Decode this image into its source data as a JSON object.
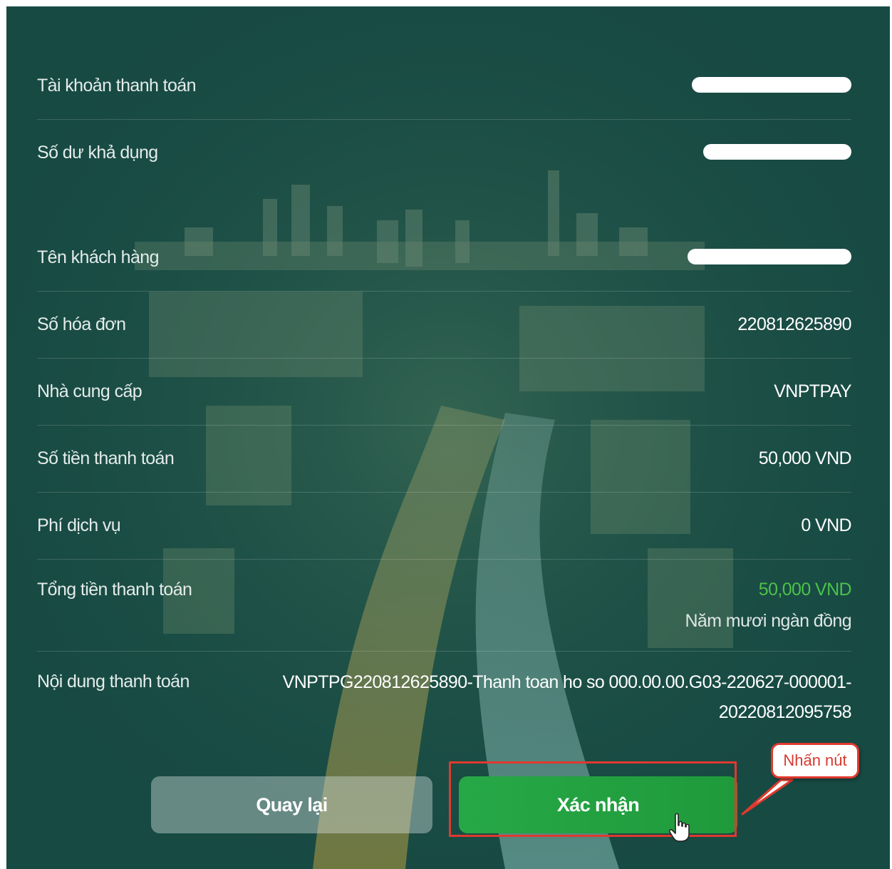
{
  "rows": [
    {
      "label": "Tài khoản thanh toán",
      "value": ""
    },
    {
      "label": "Số dư khả dụng",
      "value": ""
    },
    {
      "label": "Tên khách hàng",
      "value": ""
    },
    {
      "label": "Số hóa đơn",
      "value": "220812625890"
    },
    {
      "label": "Nhà cung cấp",
      "value": "VNPTPAY"
    },
    {
      "label": "Số tiền thanh toán",
      "value": "50,000 VND"
    },
    {
      "label": "Phí dịch vụ",
      "value": "0 VND"
    },
    {
      "label": "Tổng tiền thanh toán",
      "value": "50,000 VND",
      "subvalue": "Năm mươi ngàn đồng"
    },
    {
      "label": "Nội dung thanh toán",
      "value": "VNPTPG220812625890-Thanh toan ho so 000.00.00.G03-220627-000001-20220812095758"
    }
  ],
  "buttons": {
    "back": "Quay lại",
    "confirm": "Xác nhận"
  },
  "annotation": {
    "callout": "Nhấn nút"
  },
  "colors": {
    "panel_background": "#174a43",
    "total_amount": "#4cc24a",
    "confirm_button": "#27a847",
    "highlight": "#e0392e"
  }
}
